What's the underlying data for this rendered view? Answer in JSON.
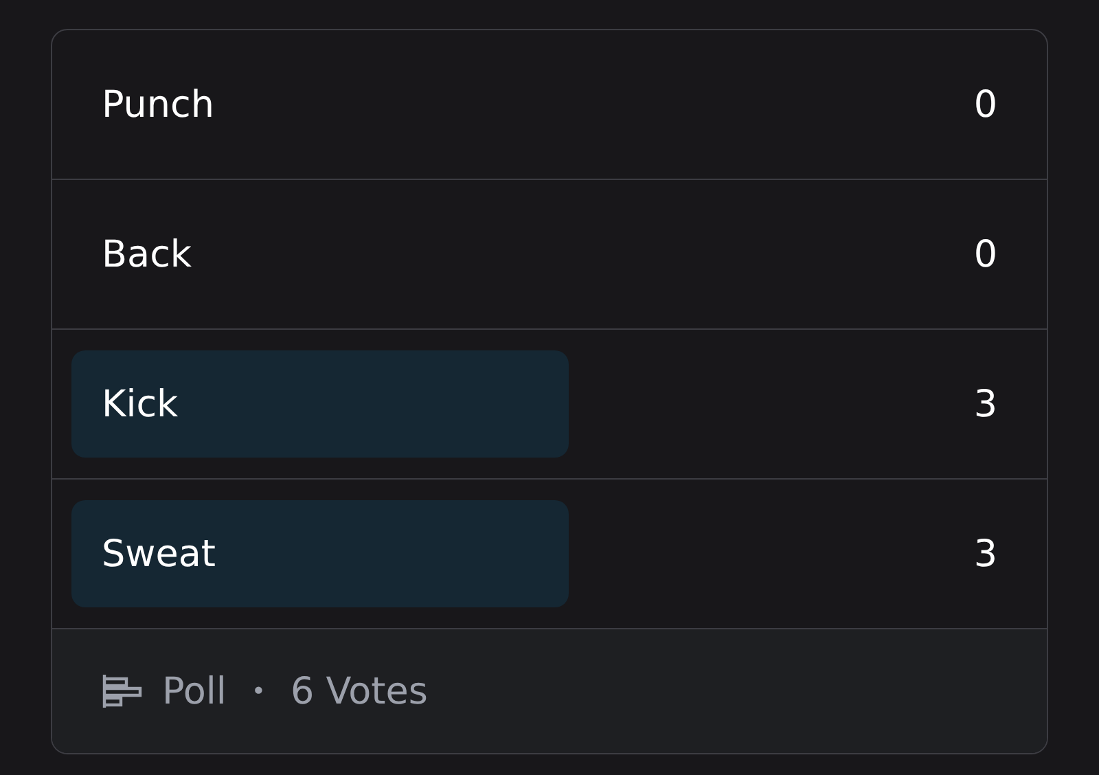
{
  "poll": {
    "options": [
      {
        "label": "Punch",
        "count": "0",
        "leading": false
      },
      {
        "label": "Back",
        "count": "0",
        "leading": false
      },
      {
        "label": "Kick",
        "count": "3",
        "leading": true
      },
      {
        "label": "Sweat",
        "count": "3",
        "leading": true
      }
    ],
    "footer": {
      "type": "Poll",
      "separator": "•",
      "votes": "6 Votes"
    }
  }
}
